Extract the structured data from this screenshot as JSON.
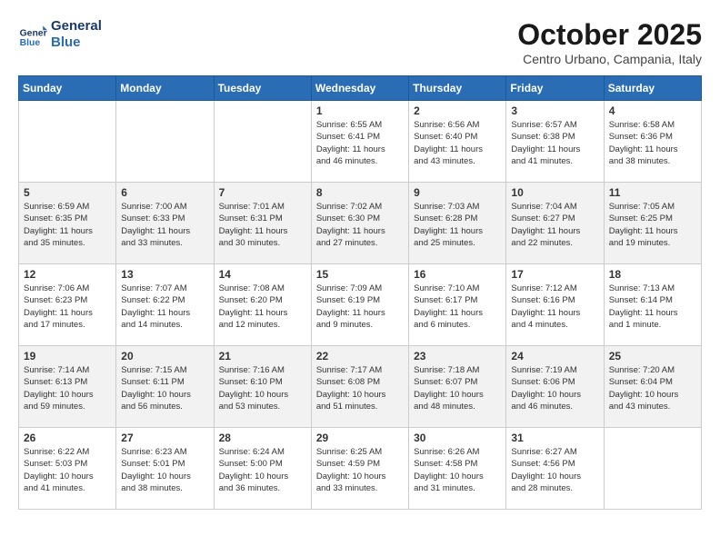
{
  "logo": {
    "line1": "General",
    "line2": "Blue"
  },
  "title": "October 2025",
  "subtitle": "Centro Urbano, Campania, Italy",
  "days_header": [
    "Sunday",
    "Monday",
    "Tuesday",
    "Wednesday",
    "Thursday",
    "Friday",
    "Saturday"
  ],
  "weeks": [
    [
      {
        "day": "",
        "content": ""
      },
      {
        "day": "",
        "content": ""
      },
      {
        "day": "",
        "content": ""
      },
      {
        "day": "1",
        "content": "Sunrise: 6:55 AM\nSunset: 6:41 PM\nDaylight: 11 hours\nand 46 minutes."
      },
      {
        "day": "2",
        "content": "Sunrise: 6:56 AM\nSunset: 6:40 PM\nDaylight: 11 hours\nand 43 minutes."
      },
      {
        "day": "3",
        "content": "Sunrise: 6:57 AM\nSunset: 6:38 PM\nDaylight: 11 hours\nand 41 minutes."
      },
      {
        "day": "4",
        "content": "Sunrise: 6:58 AM\nSunset: 6:36 PM\nDaylight: 11 hours\nand 38 minutes."
      }
    ],
    [
      {
        "day": "5",
        "content": "Sunrise: 6:59 AM\nSunset: 6:35 PM\nDaylight: 11 hours\nand 35 minutes."
      },
      {
        "day": "6",
        "content": "Sunrise: 7:00 AM\nSunset: 6:33 PM\nDaylight: 11 hours\nand 33 minutes."
      },
      {
        "day": "7",
        "content": "Sunrise: 7:01 AM\nSunset: 6:31 PM\nDaylight: 11 hours\nand 30 minutes."
      },
      {
        "day": "8",
        "content": "Sunrise: 7:02 AM\nSunset: 6:30 PM\nDaylight: 11 hours\nand 27 minutes."
      },
      {
        "day": "9",
        "content": "Sunrise: 7:03 AM\nSunset: 6:28 PM\nDaylight: 11 hours\nand 25 minutes."
      },
      {
        "day": "10",
        "content": "Sunrise: 7:04 AM\nSunset: 6:27 PM\nDaylight: 11 hours\nand 22 minutes."
      },
      {
        "day": "11",
        "content": "Sunrise: 7:05 AM\nSunset: 6:25 PM\nDaylight: 11 hours\nand 19 minutes."
      }
    ],
    [
      {
        "day": "12",
        "content": "Sunrise: 7:06 AM\nSunset: 6:23 PM\nDaylight: 11 hours\nand 17 minutes."
      },
      {
        "day": "13",
        "content": "Sunrise: 7:07 AM\nSunset: 6:22 PM\nDaylight: 11 hours\nand 14 minutes."
      },
      {
        "day": "14",
        "content": "Sunrise: 7:08 AM\nSunset: 6:20 PM\nDaylight: 11 hours\nand 12 minutes."
      },
      {
        "day": "15",
        "content": "Sunrise: 7:09 AM\nSunset: 6:19 PM\nDaylight: 11 hours\nand 9 minutes."
      },
      {
        "day": "16",
        "content": "Sunrise: 7:10 AM\nSunset: 6:17 PM\nDaylight: 11 hours\nand 6 minutes."
      },
      {
        "day": "17",
        "content": "Sunrise: 7:12 AM\nSunset: 6:16 PM\nDaylight: 11 hours\nand 4 minutes."
      },
      {
        "day": "18",
        "content": "Sunrise: 7:13 AM\nSunset: 6:14 PM\nDaylight: 11 hours\nand 1 minute."
      }
    ],
    [
      {
        "day": "19",
        "content": "Sunrise: 7:14 AM\nSunset: 6:13 PM\nDaylight: 10 hours\nand 59 minutes."
      },
      {
        "day": "20",
        "content": "Sunrise: 7:15 AM\nSunset: 6:11 PM\nDaylight: 10 hours\nand 56 minutes."
      },
      {
        "day": "21",
        "content": "Sunrise: 7:16 AM\nSunset: 6:10 PM\nDaylight: 10 hours\nand 53 minutes."
      },
      {
        "day": "22",
        "content": "Sunrise: 7:17 AM\nSunset: 6:08 PM\nDaylight: 10 hours\nand 51 minutes."
      },
      {
        "day": "23",
        "content": "Sunrise: 7:18 AM\nSunset: 6:07 PM\nDaylight: 10 hours\nand 48 minutes."
      },
      {
        "day": "24",
        "content": "Sunrise: 7:19 AM\nSunset: 6:06 PM\nDaylight: 10 hours\nand 46 minutes."
      },
      {
        "day": "25",
        "content": "Sunrise: 7:20 AM\nSunset: 6:04 PM\nDaylight: 10 hours\nand 43 minutes."
      }
    ],
    [
      {
        "day": "26",
        "content": "Sunrise: 6:22 AM\nSunset: 5:03 PM\nDaylight: 10 hours\nand 41 minutes."
      },
      {
        "day": "27",
        "content": "Sunrise: 6:23 AM\nSunset: 5:01 PM\nDaylight: 10 hours\nand 38 minutes."
      },
      {
        "day": "28",
        "content": "Sunrise: 6:24 AM\nSunset: 5:00 PM\nDaylight: 10 hours\nand 36 minutes."
      },
      {
        "day": "29",
        "content": "Sunrise: 6:25 AM\nSunset: 4:59 PM\nDaylight: 10 hours\nand 33 minutes."
      },
      {
        "day": "30",
        "content": "Sunrise: 6:26 AM\nSunset: 4:58 PM\nDaylight: 10 hours\nand 31 minutes."
      },
      {
        "day": "31",
        "content": "Sunrise: 6:27 AM\nSunset: 4:56 PM\nDaylight: 10 hours\nand 28 minutes."
      },
      {
        "day": "",
        "content": ""
      }
    ]
  ]
}
